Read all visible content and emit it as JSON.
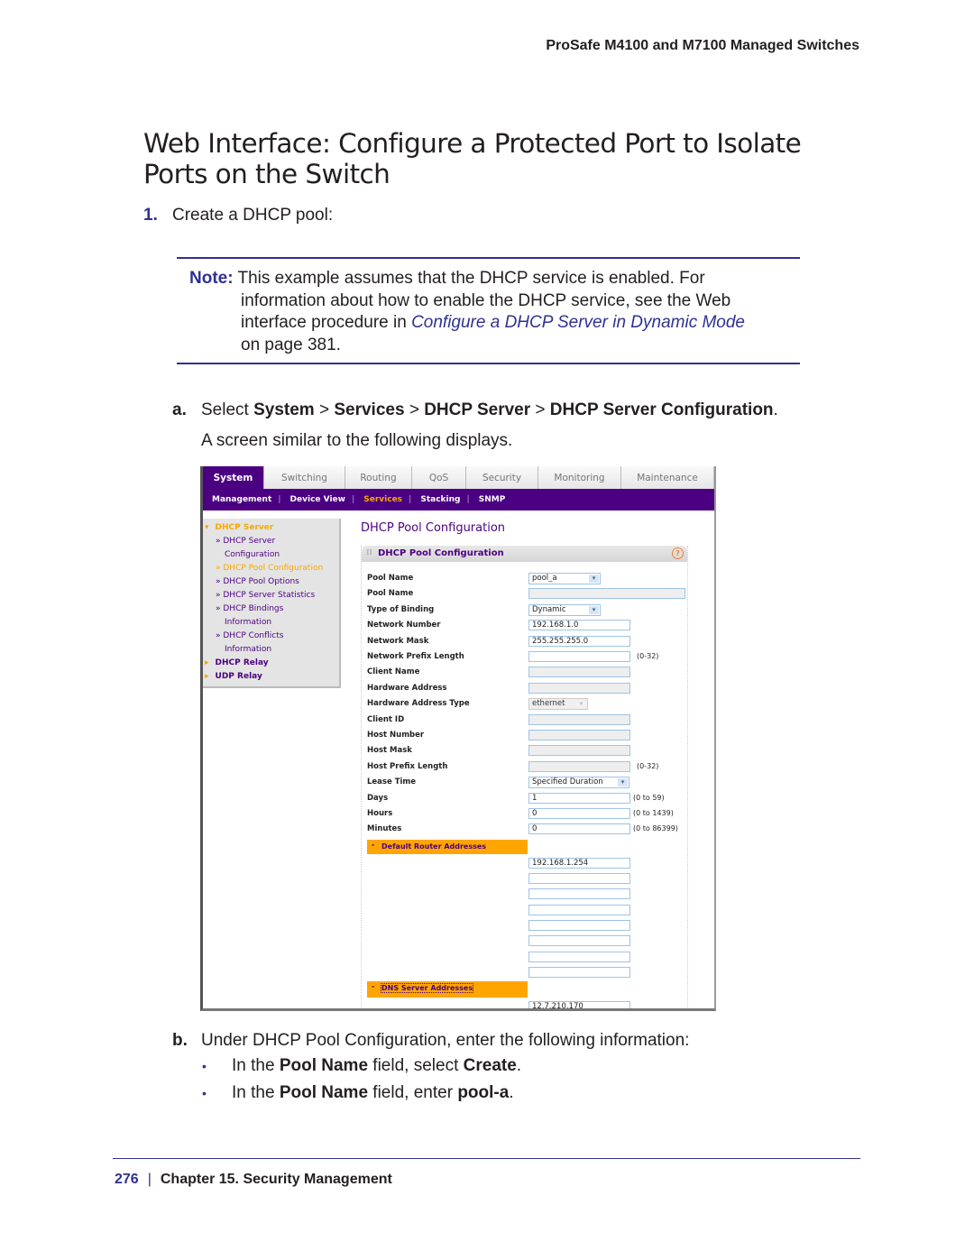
{
  "running_header": "ProSafe M4100 and M7100 Managed Switches",
  "section_title": "Web Interface: Configure a Protected Port to Isolate Ports on the Switch",
  "step1": {
    "number": "1.",
    "text": "Create a DHCP pool:"
  },
  "note": {
    "label": "Note:",
    "line1": "This example assumes that the DHCP service is enabled. For",
    "line2": "information about how to enable the DHCP service, see the Web",
    "line3_pre": "interface procedure in ",
    "link": "Configure a DHCP Server in Dynamic Mode",
    "line4": "on page 381."
  },
  "step_a": {
    "letter": "a.",
    "pre": "Select ",
    "path": [
      {
        "text": "System",
        "bold": true
      },
      {
        "text": " > ",
        "bold": false
      },
      {
        "text": "Services",
        "bold": true
      },
      {
        "text": " > ",
        "bold": false
      },
      {
        "text": "DHCP Server",
        "bold": true
      },
      {
        "text": " > ",
        "bold": false
      },
      {
        "text": "DHCP Server Configuration",
        "bold": true
      }
    ],
    "end": ".",
    "sub": "A screen similar to the following displays."
  },
  "screenshot": {
    "tabs": [
      "System",
      "Switching",
      "Routing",
      "QoS",
      "Security",
      "Monitoring",
      "Maintenance"
    ],
    "active_tab": "System",
    "subnav": [
      "Management",
      "Device View",
      "Services",
      "Stacking",
      "SNMP"
    ],
    "active_subnav": "Services",
    "leftnav": [
      {
        "label": "DHCP Server",
        "prefix": "▾",
        "level": "top",
        "color": "orange"
      },
      {
        "label": "» DHCP Server",
        "level": "sub",
        "color": "purple"
      },
      {
        "label": "Configuration",
        "level": "cont",
        "color": "purple"
      },
      {
        "label": "» DHCP Pool Configuration",
        "level": "sub",
        "color": "orange"
      },
      {
        "label": "» DHCP Pool Options",
        "level": "sub",
        "color": "purple"
      },
      {
        "label": "» DHCP Server Statistics",
        "level": "sub",
        "color": "purple"
      },
      {
        "label": "» DHCP Bindings",
        "level": "sub",
        "color": "purple"
      },
      {
        "label": "Information",
        "level": "cont",
        "color": "purple"
      },
      {
        "label": "» DHCP Conflicts",
        "level": "sub",
        "color": "purple"
      },
      {
        "label": "Information",
        "level": "cont",
        "color": "purple"
      },
      {
        "label": "DHCP Relay",
        "prefix": "▸",
        "level": "top",
        "color": "purple"
      },
      {
        "label": "UDP Relay",
        "prefix": "▸",
        "level": "top",
        "color": "purple"
      }
    ],
    "page_title": "DHCP Pool Configuration",
    "panel_title": "DHCP Pool Configuration",
    "help_icon": "?",
    "fields": [
      {
        "label": "Pool Name",
        "type": "select",
        "value": "pool_a"
      },
      {
        "label": "Pool Name",
        "type": "text-disabled-wide",
        "value": ""
      },
      {
        "label": "Type of Binding",
        "type": "select",
        "value": "Dynamic"
      },
      {
        "label": "Network Number",
        "type": "text",
        "value": "192.168.1.0"
      },
      {
        "label": "Network Mask",
        "type": "text",
        "value": "255.255.255.0"
      },
      {
        "label": "Network Prefix Length",
        "type": "text",
        "value": "",
        "range": "(0-32)"
      },
      {
        "label": "Client Name",
        "type": "text-disabled",
        "value": ""
      },
      {
        "label": "Hardware Address",
        "type": "text-disabled",
        "value": ""
      },
      {
        "label": "Hardware Address Type",
        "type": "select-disabled",
        "value": "ethernet"
      },
      {
        "label": "Client ID",
        "type": "text-disabled",
        "value": ""
      },
      {
        "label": "Host Number",
        "type": "text-disabled",
        "value": ""
      },
      {
        "label": "Host Mask",
        "type": "text-disabled",
        "value": ""
      },
      {
        "label": "Host Prefix Length",
        "type": "text-disabled",
        "value": "",
        "range": "(0-32)"
      },
      {
        "label": "Lease Time",
        "type": "select-wide",
        "value": "Specified Duration"
      },
      {
        "label": "Days",
        "type": "text",
        "value": "1",
        "range": "(0 to 59)"
      },
      {
        "label": "Hours",
        "type": "text",
        "value": "0",
        "range": "(0 to 1439)"
      },
      {
        "label": "Minutes",
        "type": "text",
        "value": "0",
        "range": "(0 to 86399)"
      }
    ],
    "default_router_section": "Default Router Addresses",
    "default_router_addresses": [
      "192.168.1.254",
      "",
      "",
      "",
      "",
      "",
      "",
      ""
    ],
    "dns_section": "DNS Server Addresses",
    "dns_server_addresses": [
      "12.7.210.170"
    ]
  },
  "step_b": {
    "letter": "b.",
    "text": "Under DHCP Pool Configuration, enter the following information:",
    "bullets": [
      {
        "pre": "In the ",
        "b1": "Pool Name",
        "mid": " field, select ",
        "b2": "Create",
        "end": "."
      },
      {
        "pre": "In the ",
        "b1": "Pool Name",
        "mid": " field, enter ",
        "b2": "pool-a",
        "end": "."
      }
    ]
  },
  "footer": {
    "page": "276",
    "separator": "|",
    "chapter": "Chapter 15.  Security Management"
  }
}
